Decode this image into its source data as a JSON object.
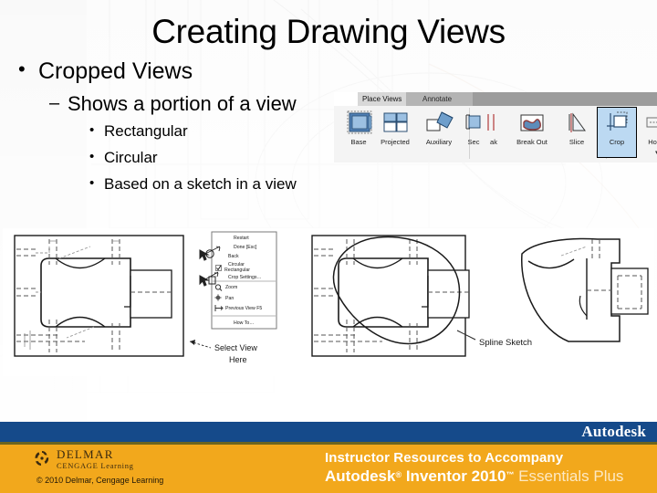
{
  "slide": {
    "title": "Creating Drawing Views",
    "bullets": [
      {
        "level": 1,
        "marker": "•",
        "text": "Cropped Views"
      },
      {
        "level": 2,
        "marker": "–",
        "text": "Shows a portion of a view"
      },
      {
        "level": 3,
        "marker": "•",
        "text": "Rectangular"
      },
      {
        "level": 3,
        "marker": "•",
        "text": "Circular"
      },
      {
        "level": 3,
        "marker": "•",
        "text": "Based on a sketch in a view"
      }
    ]
  },
  "ribbon": {
    "tabs": [
      {
        "label": "Place Views",
        "active": true
      },
      {
        "label": "Annotate",
        "active": false
      }
    ],
    "buttons": [
      {
        "label": "Base",
        "icon": "base-view-icon",
        "selected": false
      },
      {
        "label": "Projected",
        "icon": "projected-view-icon",
        "selected": false
      },
      {
        "label": "Auxiliary",
        "icon": "auxiliary-view-icon",
        "selected": false
      },
      {
        "label": "Sec",
        "icon": "section-view-icon",
        "selected": false
      },
      {
        "label": "ak",
        "icon": "break-icon",
        "selected": false
      },
      {
        "label": "Break Out",
        "icon": "break-out-icon",
        "selected": false
      },
      {
        "label": "Slice",
        "icon": "slice-icon",
        "selected": false
      },
      {
        "label": "Crop",
        "icon": "crop-icon",
        "selected": true
      },
      {
        "label": "Horiz",
        "icon": "horizontal-break-icon",
        "selected": false
      }
    ]
  },
  "illustration": {
    "context_menu": {
      "items": [
        {
          "label": "Restart",
          "checked": false
        },
        {
          "label": "Done [Esc]",
          "checked": false
        },
        {
          "label": "Back",
          "checked": false
        },
        {
          "label": "Circular",
          "checked": false
        },
        {
          "label": "Rectangular",
          "checked": true
        },
        {
          "label": "Crop Settings...",
          "checked": false
        },
        {
          "label": "Zoom",
          "checked": false,
          "icon": "zoom-icon"
        },
        {
          "label": "Pan",
          "checked": false,
          "icon": "pan-icon"
        },
        {
          "label": "Previous View  F5",
          "checked": false,
          "icon": "previous-view-icon"
        },
        {
          "label": "How To...",
          "checked": false
        }
      ]
    },
    "callouts": [
      {
        "name": "select-view-here",
        "line1": "Select View",
        "line2": "Here"
      },
      {
        "name": "spline-sketch",
        "line1": "Spline Sketch",
        "line2": ""
      }
    ]
  },
  "footer": {
    "autodesk_watermark": "Autodesk",
    "delmar_name": "DELMAR",
    "delmar_sub": "CENGAGE Learning",
    "copyright": "© 2010  Delmar, Cengage Learning",
    "instructor_line1": "Instructor Resources to Accompany",
    "instructor_brand": "Autodesk",
    "instructor_reg": "®",
    "instructor_product": " Inventor 2010",
    "instructor_tm": "™",
    "instructor_edition": " Essentials Plus"
  },
  "colors": {
    "footer_blue": "#154a8a",
    "footer_orange": "#f2a81c",
    "olive_rule": "#6b6420",
    "ribbon_selected": "#bcd9f2",
    "ribbon_tab_strip": "#b4b4b4"
  }
}
